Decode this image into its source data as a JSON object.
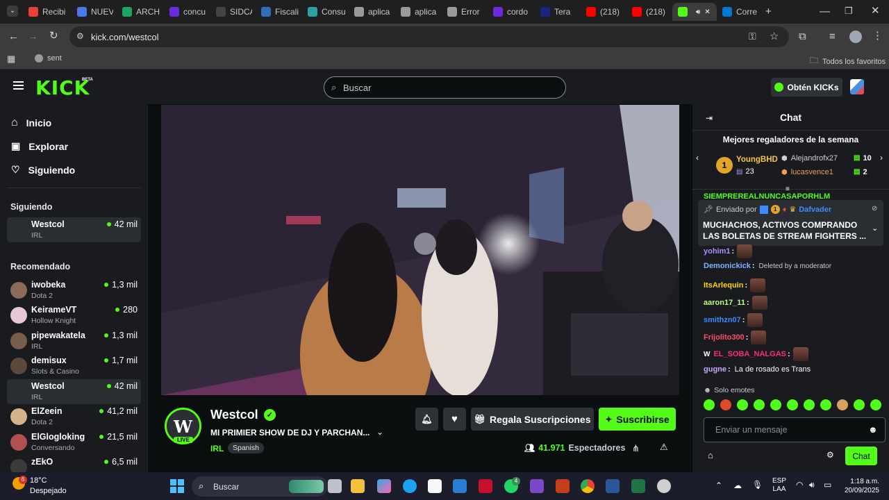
{
  "browser": {
    "tabs": [
      {
        "label": "Recibi",
        "color": "#ea4335"
      },
      {
        "label": "NUEV",
        "color": "#4a7ae8"
      },
      {
        "label": "ARCH",
        "color": "#1fa463"
      },
      {
        "label": "concu",
        "color": "#6c2bd9"
      },
      {
        "label": "SIDCA",
        "color": "#444444"
      },
      {
        "label": "Fiscali",
        "color": "#2e6fb8"
      },
      {
        "label": "Consu",
        "color": "#2aa3a0"
      },
      {
        "label": "aplica",
        "color": "#9a9a9a"
      },
      {
        "label": "aplica",
        "color": "#9a9a9a"
      },
      {
        "label": "Error",
        "color": "#9a9a9a"
      },
      {
        "label": "cordo",
        "color": "#6c2bd9"
      },
      {
        "label": "Tera",
        "color": "#1a237e"
      },
      {
        "label": "(218)",
        "color": "#ff0000"
      },
      {
        "label": "(218)",
        "color": "#ff0000"
      },
      {
        "label": "",
        "color": "#53fc18"
      },
      {
        "label": "Corre",
        "color": "#0078d4"
      }
    ],
    "url": "kick.com/westcol",
    "bookmark": "sent",
    "all_bookmarks": "Todos los favoritos"
  },
  "header": {
    "logo": "KICK",
    "beta": "BETA",
    "search_placeholder": "Buscar",
    "get_kicks": "Obtén KICKs"
  },
  "sidebar": {
    "nav": [
      {
        "label": "Inicio",
        "icon": "home-icon"
      },
      {
        "label": "Explorar",
        "icon": "explore-icon"
      },
      {
        "label": "Siguiendo",
        "icon": "heart-icon"
      }
    ],
    "following_title": "Siguiendo",
    "following": [
      {
        "name": "Westcol",
        "category": "IRL",
        "viewers": "42 mil"
      }
    ],
    "recommended_title": "Recomendado",
    "recommended": [
      {
        "name": "iwobeka",
        "category": "Dota 2",
        "viewers": "1,3 mil"
      },
      {
        "name": "KeirameVT",
        "category": "Hollow Knight",
        "viewers": "280"
      },
      {
        "name": "pipewakatela",
        "category": "IRL",
        "viewers": "1,3 mil"
      },
      {
        "name": "demisux",
        "category": "Slots & Casino",
        "viewers": "1,7 mil"
      },
      {
        "name": "Westcol",
        "category": "IRL",
        "viewers": "42 mil"
      },
      {
        "name": "ElZeein",
        "category": "Dota 2",
        "viewers": "41,2 mil"
      },
      {
        "name": "ElGlogloking",
        "category": "Conversando",
        "viewers": "21,5 mil"
      },
      {
        "name": "zEkO",
        "category": "",
        "viewers": "6,5 mil"
      }
    ]
  },
  "stream": {
    "channel": "Westcol",
    "live_badge": "LIVE",
    "title": "MI PRIMIER SHOW DE DJ Y PARCHAN...",
    "category": "IRL",
    "language": "Spanish",
    "gift_subs": "Regala Suscripciones",
    "subscribe": "Suscribirse",
    "viewers": "41.971",
    "viewers_label": "Espectadores"
  },
  "chat": {
    "title": "Chat",
    "gifters_title": "Mejores regaladores de la semana",
    "gifters": [
      {
        "rank": "1",
        "name": "YoungBHD",
        "count": "23"
      },
      {
        "name": "Alejandrofx27",
        "count": "10"
      },
      {
        "name": "lucasvence1",
        "count": "2"
      }
    ],
    "pinned_sent_by": "Enviado por",
    "pinned_user": "Dafvader",
    "pinned_badge": "1",
    "pinned_text": "MUCHACHOS, ACTIVOS COMPRANDO LAS BOLETAS DE STREAM FIGHTERS ...",
    "top_clipped": "SIEMPREREALNUNCASAPORHLM",
    "messages": [
      {
        "user": "yohim1",
        "text": "",
        "color": "#b08cff"
      },
      {
        "user": "Demonickick",
        "text": "Deleted by a moderator",
        "color": "#7fb2ff"
      },
      {
        "user": "ItsArlequin",
        "text": "",
        "color": "#ffd400"
      },
      {
        "user": "aaron17_11",
        "text": "",
        "color": "#b6ff7f"
      },
      {
        "user": "smithzn07",
        "text": "",
        "color": "#3d8bff"
      },
      {
        "user": "Frijolito300",
        "text": "",
        "color": "#ff4d6a"
      },
      {
        "user": "EL_SOBA_NALGAS",
        "text": "",
        "color": "#ff2d6f"
      },
      {
        "user": "gugne",
        "text": "La de rosado es Trans",
        "color": "#c9a7ff"
      }
    ],
    "emotes_only": "Solo emotes",
    "input_placeholder": "Enviar un mensaje",
    "send_button": "Chat"
  },
  "taskbar": {
    "temperature": "18°C",
    "weather": "Despejado",
    "search": "Buscar",
    "lang1": "ESP",
    "lang2": "LAA",
    "time": "1:18 a.m.",
    "date": "20/09/2025",
    "weather_badge": "6",
    "whatsapp_badge": "4"
  },
  "colors": {
    "kick_green": "#53fc18",
    "panel": "#191b1f",
    "bg": "#0b0e0f"
  }
}
